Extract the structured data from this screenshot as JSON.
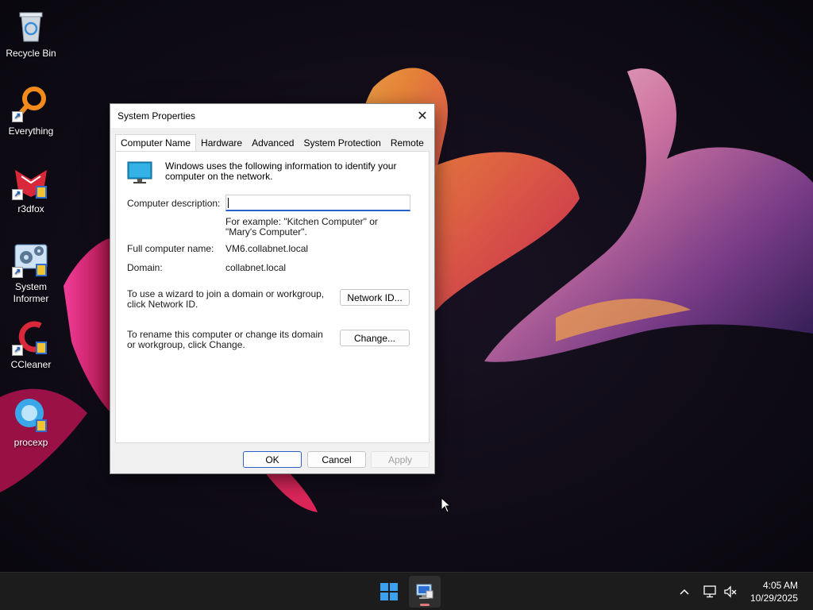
{
  "desktop": {
    "icons": [
      {
        "label": "Recycle Bin",
        "icon": "recycle-bin-icon"
      },
      {
        "label": "Everything",
        "icon": "everything-icon"
      },
      {
        "label": "r3dfox",
        "icon": "r3dfox-icon"
      },
      {
        "label": "System Informer",
        "icon": "system-informer-icon"
      },
      {
        "label": "CCleaner",
        "icon": "ccleaner-icon"
      },
      {
        "label": "procexp",
        "icon": "procexp-icon"
      }
    ]
  },
  "dialog": {
    "title": "System Properties",
    "close_glyph": "✕",
    "tabs": [
      "Computer Name",
      "Hardware",
      "Advanced",
      "System Protection",
      "Remote"
    ],
    "active_tab": "Computer Name",
    "info_text": "Windows uses the following information to identify your computer on the network.",
    "description_label": "Computer description:",
    "description_value": "",
    "example_text": "For example: \"Kitchen Computer\" or \"Mary's Computer\".",
    "full_name_label": "Full computer name:",
    "full_name_value": "VM6.collabnet.local",
    "domain_label": "Domain:",
    "domain_value": "collabnet.local",
    "network_id_text": "To use a wizard to join a domain or workgroup, click Network ID.",
    "network_id_button": "Network ID...",
    "rename_text": "To rename this computer or change its domain or workgroup, click Change.",
    "change_button": "Change...",
    "ok_button": "OK",
    "cancel_button": "Cancel",
    "apply_button": "Apply"
  },
  "taskbar": {
    "tray_chevron": "^",
    "time": "4:05 AM",
    "date": "10/29/2025"
  },
  "colors": {
    "accent": "#2a61c8",
    "taskbar_bg": "#1c1c1c",
    "dialog_bg": "#f0f0f0"
  }
}
